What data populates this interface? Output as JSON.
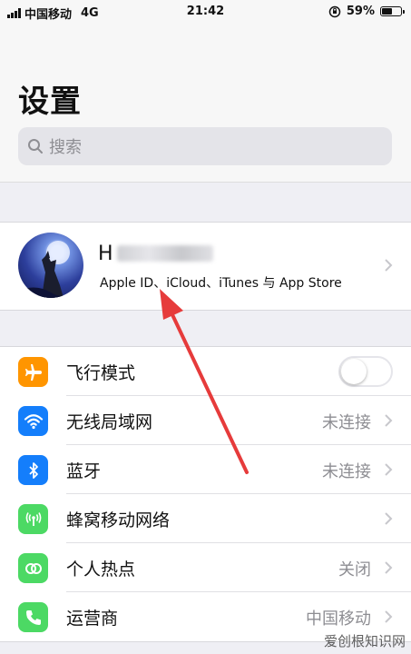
{
  "status_bar": {
    "carrier": "中国移动",
    "network": "4G",
    "time": "21:42",
    "battery": "59%",
    "battery_level": 0.59
  },
  "header": {
    "title": "设置",
    "search_placeholder": "搜索"
  },
  "profile": {
    "name_visible": "H",
    "subtitle": "Apple ID、iCloud、iTunes 与 App Store"
  },
  "settings": [
    {
      "label": "飞行模式",
      "icon": "airplane-icon",
      "color": "#ff9500",
      "toggle": false,
      "value": ""
    },
    {
      "label": "无线局域网",
      "icon": "wifi-icon",
      "color": "#147efb",
      "value": "未连接"
    },
    {
      "label": "蓝牙",
      "icon": "bluetooth-icon",
      "color": "#147efb",
      "value": "未连接"
    },
    {
      "label": "蜂窝移动网络",
      "icon": "cellular-icon",
      "color": "#4cd964",
      "value": ""
    },
    {
      "label": "个人热点",
      "icon": "hotspot-icon",
      "color": "#4cd964",
      "value": "关闭"
    },
    {
      "label": "运营商",
      "icon": "phone-icon",
      "color": "#4cd964",
      "value": "中国移动"
    }
  ],
  "annotation_color": "#e63b3b",
  "watermark": "爱创根知识网"
}
